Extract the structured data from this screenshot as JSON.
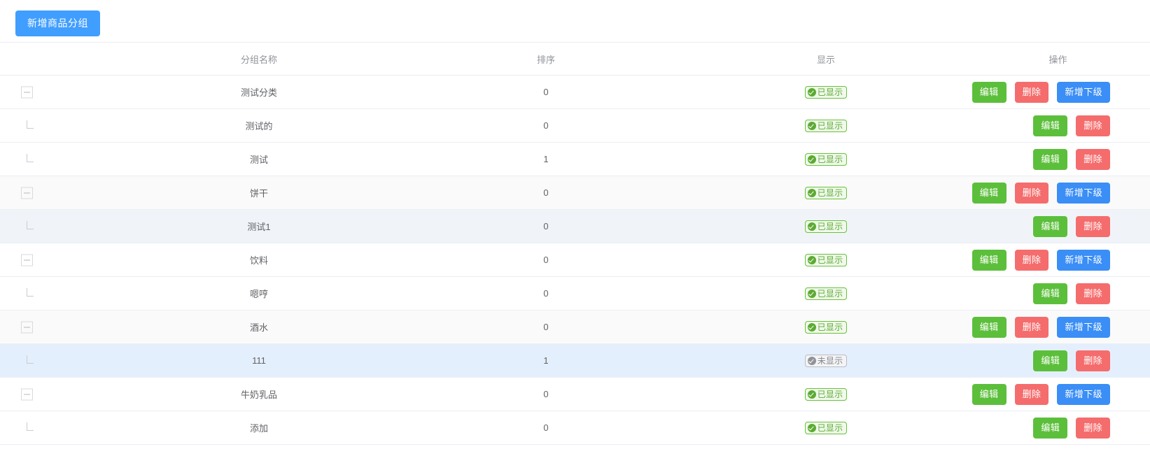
{
  "toolbar": {
    "add_group_label": "新增商品分组"
  },
  "table": {
    "headers": {
      "tree": "",
      "name": "分组名称",
      "sort": "排序",
      "show": "显示",
      "ops": "操作"
    },
    "badge_labels": {
      "shown": "已显示",
      "hidden": "未显示"
    },
    "op_labels": {
      "edit": "编辑",
      "delete": "删除",
      "add_sub": "新增下级"
    },
    "rows": [
      {
        "name": "测试分类",
        "sort": "0",
        "show": "已显示",
        "shown": true,
        "level": "parent",
        "row_style": "bg-white",
        "ops": [
          "编辑",
          "删除",
          "新增下级"
        ]
      },
      {
        "name": "测试的",
        "sort": "0",
        "show": "已显示",
        "shown": true,
        "level": "child",
        "row_style": "bg-white",
        "ops": [
          "编辑",
          "删除"
        ]
      },
      {
        "name": "测试",
        "sort": "1",
        "show": "已显示",
        "shown": true,
        "level": "child",
        "row_style": "bg-white",
        "ops": [
          "编辑",
          "删除"
        ]
      },
      {
        "name": "饼干",
        "sort": "0",
        "show": "已显示",
        "shown": true,
        "level": "parent",
        "row_style": "bg-gray",
        "ops": [
          "编辑",
          "删除",
          "新增下级"
        ]
      },
      {
        "name": "测试1",
        "sort": "0",
        "show": "已显示",
        "shown": true,
        "level": "child",
        "row_style": "bg-bluegray",
        "ops": [
          "编辑",
          "删除"
        ]
      },
      {
        "name": "饮料",
        "sort": "0",
        "show": "已显示",
        "shown": true,
        "level": "parent",
        "row_style": "bg-white",
        "ops": [
          "编辑",
          "删除",
          "新增下级"
        ]
      },
      {
        "name": "嗯哼",
        "sort": "0",
        "show": "已显示",
        "shown": true,
        "level": "child",
        "row_style": "bg-white",
        "ops": [
          "编辑",
          "删除"
        ]
      },
      {
        "name": "酒水",
        "sort": "0",
        "show": "已显示",
        "shown": true,
        "level": "parent",
        "row_style": "bg-gray",
        "ops": [
          "编辑",
          "删除",
          "新增下级"
        ]
      },
      {
        "name": "111",
        "sort": "1",
        "show": "未显示",
        "shown": false,
        "level": "child",
        "row_style": "bg-hl",
        "ops": [
          "编辑",
          "删除"
        ]
      },
      {
        "name": "牛奶乳品",
        "sort": "0",
        "show": "已显示",
        "shown": true,
        "level": "parent",
        "row_style": "bg-white",
        "ops": [
          "编辑",
          "删除",
          "新增下级"
        ]
      },
      {
        "name": "添加",
        "sort": "0",
        "show": "已显示",
        "shown": true,
        "level": "child",
        "row_style": "bg-white",
        "ops": [
          "编辑",
          "删除"
        ]
      }
    ]
  },
  "colors": {
    "primary": "#409EFF",
    "edit": "#5cbf3b",
    "delete": "#f56c6c",
    "add_sub": "#3a8ef6",
    "badge_on": "#67c23a",
    "badge_off": "#909399",
    "row_highlight": "#e4effd"
  }
}
